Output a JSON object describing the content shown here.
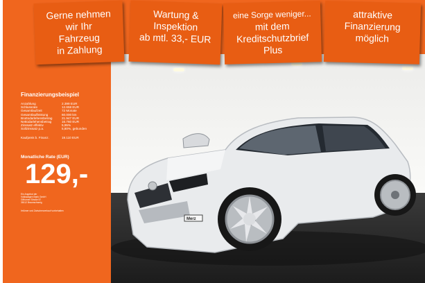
{
  "banners": [
    {
      "lines": [
        "Gerne nehmen",
        "wir Ihr",
        "Fahrzeug",
        "in Zahlung"
      ]
    },
    {
      "lines": [
        "Wartung &",
        "Inspektion",
        "ab mtl. 33,- EUR"
      ]
    },
    {
      "lines": [
        "eine Sorge weniger...",
        "mit dem",
        "Kreditschutzbrief",
        "Plus"
      ]
    },
    {
      "lines": [
        "attraktive",
        "Finanzierung",
        "möglich"
      ]
    }
  ],
  "financing": {
    "title": "Finanzierungsbeispiel",
    "rows": [
      {
        "label": "Anzahlung",
        "value": "2.399 EUR"
      },
      {
        "label": "Schlussrate",
        "value": "12.658 EUR"
      },
      {
        "label": "Gesamtlaufzeit",
        "value": "72 Monate"
      },
      {
        "label": "Gesamtlaufleistung",
        "value": "60.000 km"
      },
      {
        "label": "Bruttodarlehensbetrag",
        "value": "21.947 EUR"
      },
      {
        "label": "Nettodarlehensbetrag",
        "value": "16.760 EUR"
      },
      {
        "label": "Zinssatz effektiv",
        "value": "5,95%"
      },
      {
        "label": "Sollzinssatz p.a.",
        "value": "5,80%, gebunden"
      }
    ],
    "purchase": {
      "label": "Kaufpreis b. Finanz.",
      "value": "19.110 EUR"
    },
    "rate_label": "Monatliche Rate (EUR)",
    "rate_value": "129,-",
    "lender_lines": [
      "Ein Angebot der",
      "Volkswagen Bank GmbH",
      "Gifhorner Straße 57",
      "38112 Braunschweig"
    ],
    "footnote": "Irrtümer und Zwischenverkauf vorbehalten"
  },
  "colors": {
    "orange": "#f0661e",
    "banner": "#e85d13",
    "car": "#e8eaec"
  }
}
